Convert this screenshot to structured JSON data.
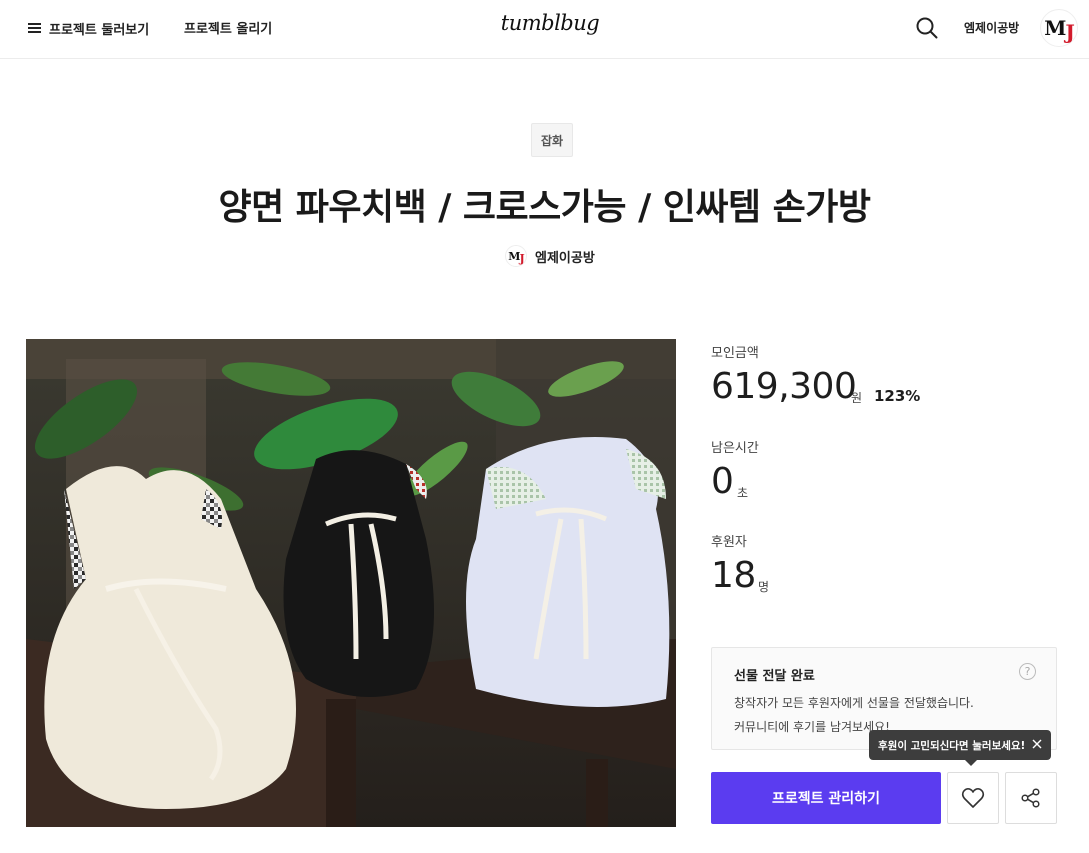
{
  "header": {
    "menu_label": "프로젝트 둘러보기",
    "upload_label": "프로젝트 올리기",
    "logo": "tumblbug",
    "user_name": "엠제이공방",
    "avatar_m": "M",
    "avatar_j": "J"
  },
  "project": {
    "category": "잡화",
    "title": "양면 파우치백 / 크로스가능 / 인싸템 손가방",
    "creator_name": "엠제이공방"
  },
  "stats": {
    "funded_label": "모인금액",
    "funded_value": "619,300",
    "funded_unit": "원",
    "funded_percent": "123%",
    "time_label": "남은시간",
    "time_value": "0",
    "time_unit": "초",
    "backers_label": "후원자",
    "backers_value": "18",
    "backers_unit": "명"
  },
  "notice": {
    "title": "선물 전달 완료",
    "line1": "창작자가 모든 후원자에게 선물을 전달했습니다.",
    "line2": "커뮤니티에 후기를 남겨보세요!",
    "help": "?"
  },
  "tooltip": {
    "text": "후원이 고민되신다면 눌러보세요!"
  },
  "actions": {
    "manage_label": "프로젝트 관리하기"
  },
  "colors": {
    "primary": "#5b3cf0",
    "tooltip_bg": "#3d3d3d",
    "logo_j": "#d21b2c"
  },
  "icons": {
    "menu": "hamburger-icon",
    "search": "search-icon",
    "help": "question-icon",
    "close": "close-icon",
    "like": "heart-icon",
    "share": "share-icon"
  }
}
